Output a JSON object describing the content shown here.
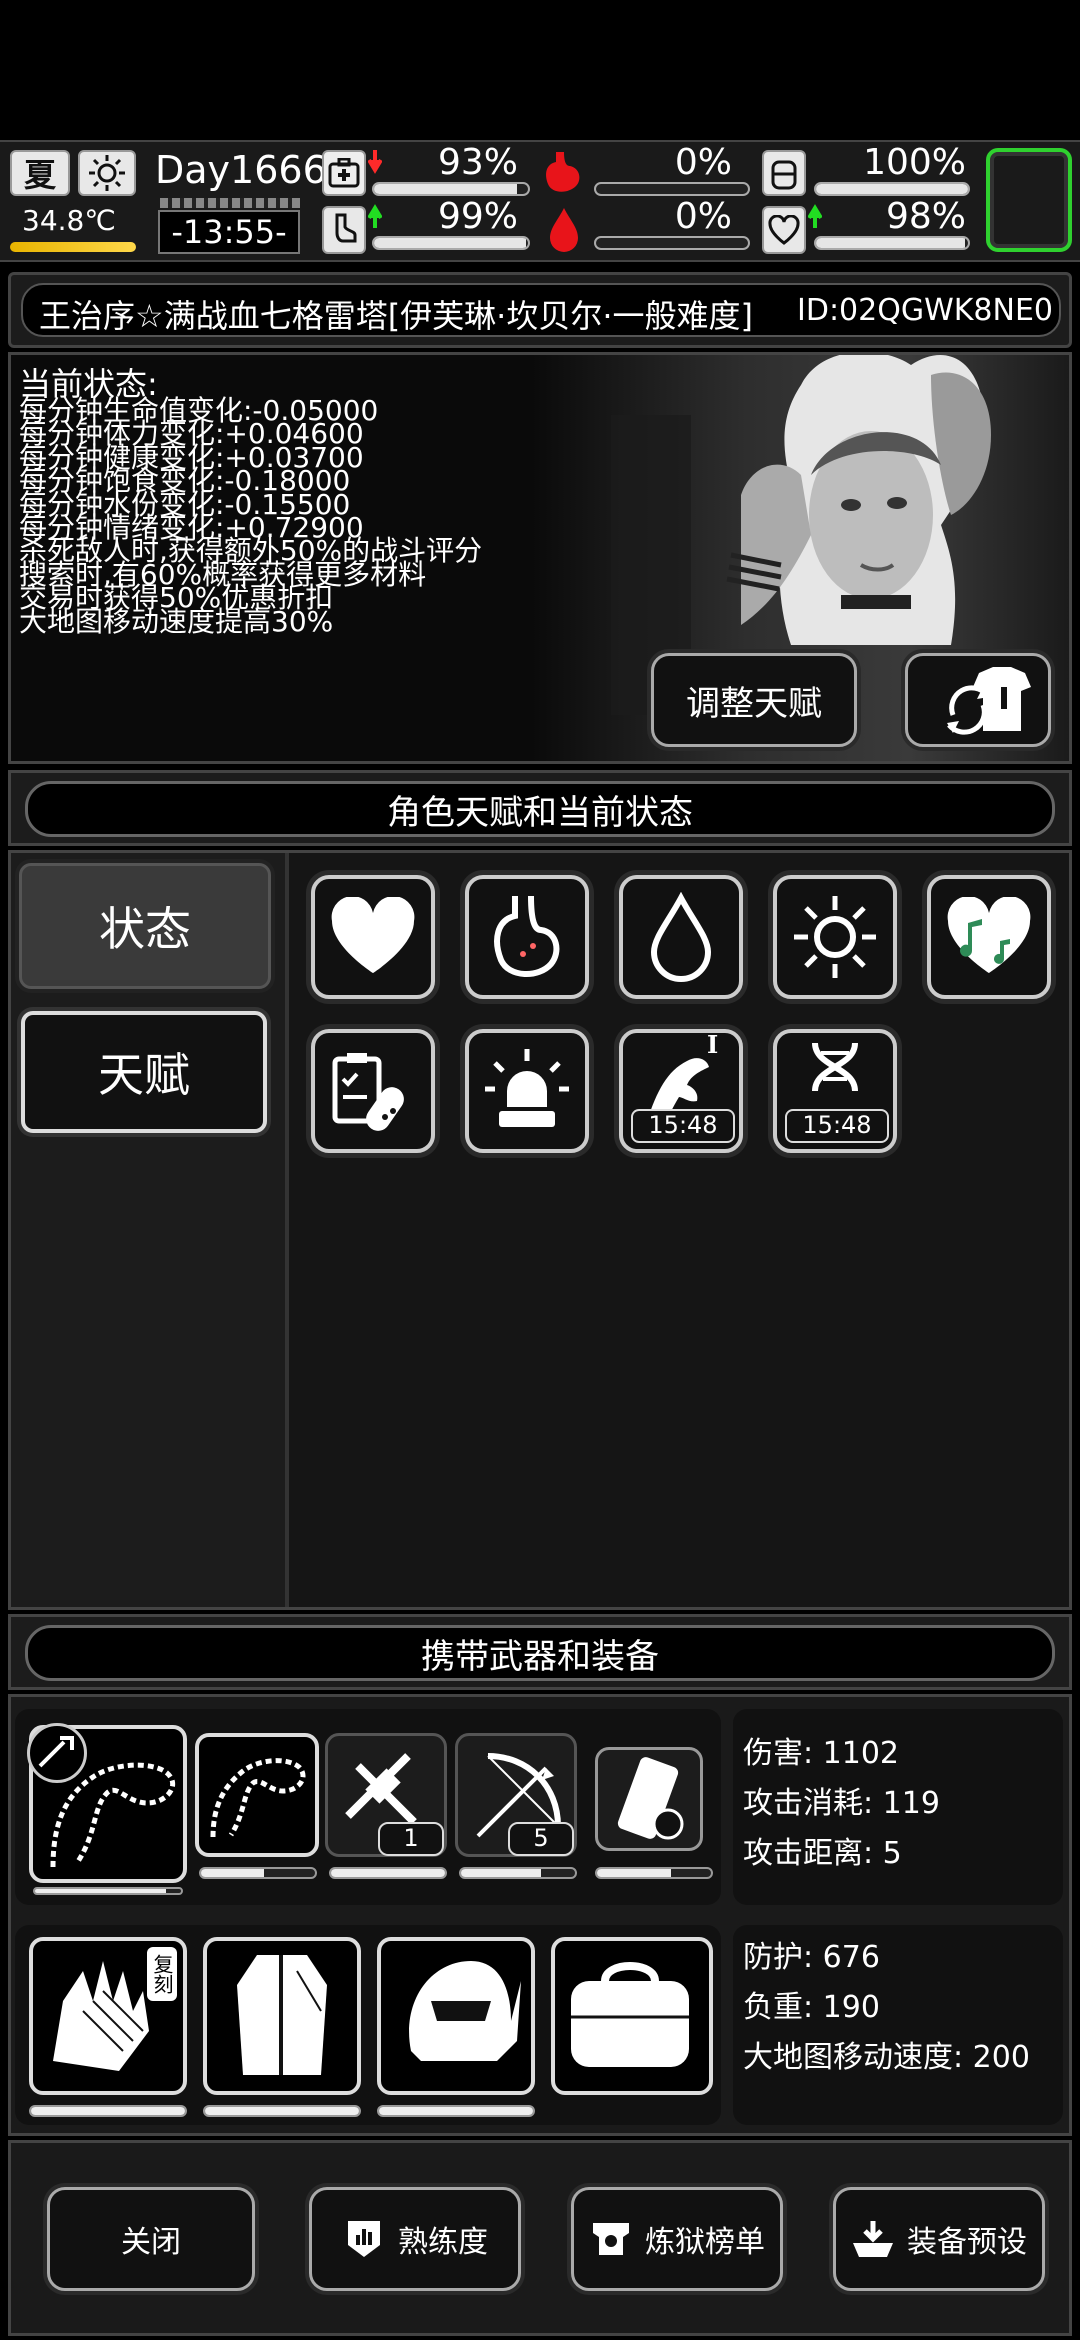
{
  "topbar": {
    "season": "夏",
    "temperature": "34.8℃",
    "day": "Day1666",
    "time": "-13:55-",
    "stats": [
      {
        "icon": "medkit-icon",
        "value": "93%",
        "fill": 0.93,
        "trend": "down",
        "trend_color": "#ff2a2a"
      },
      {
        "icon": "stomach-icon",
        "value": "0%",
        "fill": 0.0
      },
      {
        "icon": "water-jug-icon",
        "value": "100%",
        "fill": 1.0
      },
      {
        "icon": "foot-icon",
        "value": "99%",
        "fill": 0.99,
        "trend": "up",
        "trend_color": "#22dd22"
      },
      {
        "icon": "blood-drop-icon",
        "value": "0%",
        "fill": 0.0
      },
      {
        "icon": "heart-icon",
        "value": "98%",
        "fill": 0.98,
        "trend": "up",
        "trend_color": "#22dd22"
      }
    ],
    "accent_green": "#2fd12f"
  },
  "title": {
    "name": "王治序☆满战血七格雷塔[伊芙琳·坎贝尔·一般难度]",
    "id": "ID:02QGWK8NE0"
  },
  "status": {
    "heading": "当前状态:",
    "lines": [
      "每分钟生命值变化:-0.05000",
      "每分钟体力变化:+0.04600",
      "每分钟健康变化:+0.03700",
      "每分钟饱食变化:-0.18000",
      "每分钟水份变化:-0.15500",
      "每分钟情绪变化:+0.72900",
      "杀死敌人时,获得额外50%的战斗评分",
      "搜索时,有60%概率获得更多材料",
      "交易时获得50%优惠折扣",
      "大地图移动速度提高30%"
    ],
    "adjust_button": "调整天赋",
    "outfit_button_icon": "outfit-swap-icon"
  },
  "talent_section": {
    "title": "角色天赋和当前状态",
    "tabs": [
      "状态",
      "天赋"
    ],
    "icons": [
      {
        "name": "heart-icon"
      },
      {
        "name": "stomach-icon"
      },
      {
        "name": "water-drop-icon"
      },
      {
        "name": "sun-icon"
      },
      {
        "name": "music-heart-icon"
      },
      {
        "name": "medicine-icon"
      },
      {
        "name": "alarm-light-icon"
      },
      {
        "name": "arm-tattoo-icon",
        "timer": "15:48",
        "badge": "I"
      },
      {
        "name": "dna-icon",
        "timer": "15:48"
      }
    ]
  },
  "equipment": {
    "title": "携带武器和装备",
    "weapons": [
      {
        "name": "thorn-whip-icon"
      },
      {
        "name": "whip-icon"
      },
      {
        "name": "crossbow-icon",
        "count": "1"
      },
      {
        "name": "bow-icon",
        "count": "5"
      },
      {
        "name": "flashlight-shield-icon"
      }
    ],
    "weapon_bars": [
      0.9,
      0.55,
      1.0,
      0.7,
      0.65
    ],
    "weapon_stats": [
      "伤害: 1102",
      "攻击消耗: 119",
      "攻击距离: 5"
    ],
    "armor": [
      {
        "name": "gloves-icon",
        "badge": "复刻"
      },
      {
        "name": "cloak-icon"
      },
      {
        "name": "helmet-icon"
      },
      {
        "name": "bag-icon"
      }
    ],
    "armor_bars": [
      1.0,
      1.0,
      1.0
    ],
    "armor_stats": [
      "防护: 676",
      "负重: 190",
      "大地图移动速度: 200"
    ]
  },
  "bottom": {
    "buttons": [
      "关闭",
      "熟练度",
      "炼狱榜单",
      "装备预设"
    ]
  }
}
